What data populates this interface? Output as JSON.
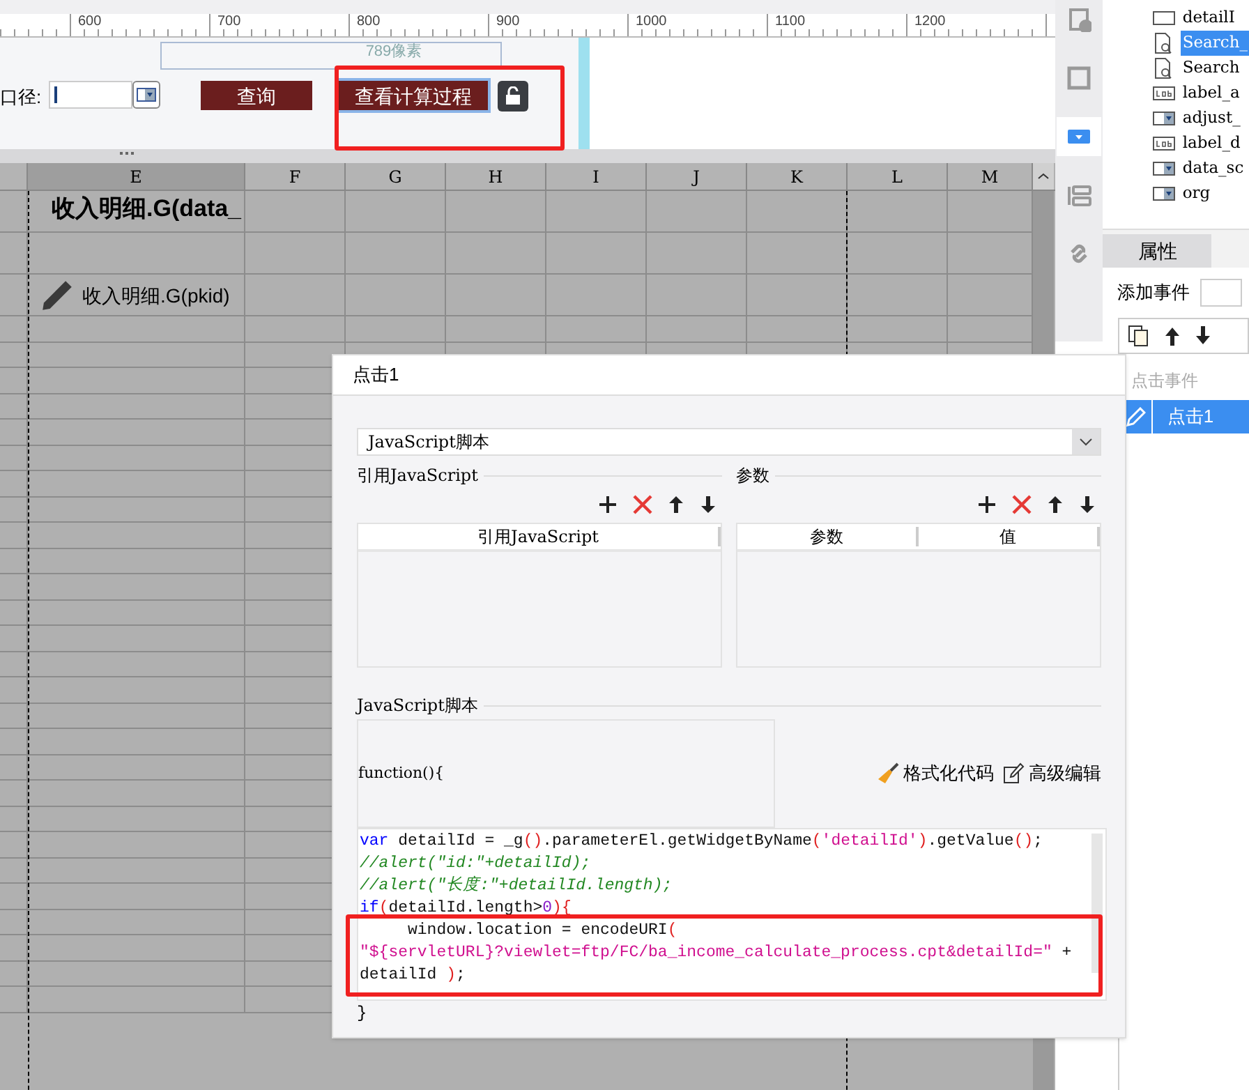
{
  "ruler": {
    "labels": [
      "600",
      "700",
      "800",
      "900",
      "1000",
      "1100",
      "1200"
    ]
  },
  "form": {
    "width_hint": "789像素",
    "field_label": "口径:",
    "buttons": [
      {
        "label": "查询",
        "selected": false
      },
      {
        "label": "查看计算过程",
        "selected": true
      }
    ]
  },
  "sheet": {
    "columns": [
      {
        "label": "E",
        "selected": true
      },
      {
        "label": "F",
        "selected": false
      },
      {
        "label": "G",
        "selected": false
      },
      {
        "label": "H",
        "selected": false
      },
      {
        "label": "I",
        "selected": false
      },
      {
        "label": "J",
        "selected": false
      },
      {
        "label": "K",
        "selected": false
      },
      {
        "label": "L",
        "selected": false
      },
      {
        "label": "M",
        "selected": false
      }
    ],
    "cells": [
      {
        "text": "收入明细.G(data_",
        "kind": "title"
      },
      {
        "text": "收入明细.G(pkid)",
        "kind": "plain"
      }
    ]
  },
  "side_tools": [
    {
      "kind": "info",
      "selected": false
    },
    {
      "kind": "frame",
      "selected": false
    },
    {
      "kind": "combo",
      "selected": true
    },
    {
      "kind": "layout",
      "selected": false
    },
    {
      "kind": "link",
      "selected": false
    }
  ],
  "tree": [
    {
      "label": "detailI",
      "kind": "box",
      "selected": false
    },
    {
      "label": "Search_",
      "kind": "search",
      "selected": true
    },
    {
      "label": "Search",
      "kind": "search",
      "selected": false
    },
    {
      "label": "label_a",
      "kind": "label",
      "selected": false
    },
    {
      "label": "adjust_",
      "kind": "combo",
      "selected": false
    },
    {
      "label": "label_d",
      "kind": "label",
      "selected": false
    },
    {
      "label": "data_sc",
      "kind": "combo",
      "selected": false
    },
    {
      "label": "org",
      "kind": "combo",
      "selected": false
    }
  ],
  "properties": {
    "tab": "属性",
    "add_event": "添加事件",
    "event_header": "点击事件",
    "events": [
      {
        "label": "点击1",
        "selected": true
      }
    ]
  },
  "dialog": {
    "title": "点击1",
    "type_select": "JavaScript脚本",
    "imports": {
      "title": "引用JavaScript",
      "columns": [
        "引用JavaScript"
      ]
    },
    "params": {
      "title": "参数",
      "columns": [
        "参数",
        "值"
      ]
    },
    "script_title": "JavaScript脚本",
    "function_header": "function(){",
    "actions": [
      "格式化代码",
      "高级编辑"
    ],
    "code": [
      [
        {
          "t": "var",
          "kind": "keyword"
        },
        {
          "t": " detailId = _g",
          "kind": "plain"
        },
        {
          "t": "()",
          "kind": "paren"
        },
        {
          "t": ".parameterEl.getWidgetByName",
          "kind": "plain"
        },
        {
          "t": "(",
          "kind": "paren"
        },
        {
          "t": "'detailId'",
          "kind": "string"
        },
        {
          "t": ")",
          "kind": "paren"
        },
        {
          "t": ".getValue",
          "kind": "plain"
        },
        {
          "t": "()",
          "kind": "paren"
        },
        {
          "t": ";",
          "kind": "plain"
        }
      ],
      [
        {
          "t": "//alert(\"id:\"+detailId);",
          "kind": "comment"
        }
      ],
      [
        {
          "t": "//alert(\"长度:\"+detailId.length);",
          "kind": "comment"
        }
      ],
      [
        {
          "t": "if",
          "kind": "keyword"
        },
        {
          "t": "(",
          "kind": "paren"
        },
        {
          "t": "detailId.length>",
          "kind": "plain"
        },
        {
          "t": "0",
          "kind": "number"
        },
        {
          "t": "){",
          "kind": "paren"
        }
      ],
      [
        {
          "t": "     window.location = encodeURI",
          "kind": "plain"
        },
        {
          "t": "(",
          "kind": "paren"
        }
      ],
      [
        {
          "t": "\"${servletURL}?viewlet=ftp/FC/ba_income_calculate_process.cpt&detailId=\"",
          "kind": "string"
        },
        {
          "t": " +",
          "kind": "plain"
        }
      ],
      [
        {
          "t": "detailId ",
          "kind": "plain"
        },
        {
          "t": ")",
          "kind": "paren"
        },
        {
          "t": ";",
          "kind": "plain"
        }
      ]
    ],
    "closing": "}"
  }
}
